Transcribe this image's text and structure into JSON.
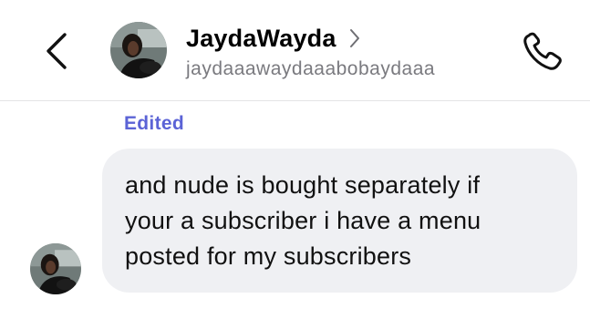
{
  "header": {
    "back_icon": "chevron-left-icon",
    "contact": {
      "display_name": "JaydaWayda",
      "username": "jaydaaawaydaaabobaydaaa",
      "chevron_icon": "chevron-right-icon"
    },
    "call_icon": "phone-icon"
  },
  "conversation": {
    "messages": [
      {
        "status": "Edited",
        "text": "and nude is bought separately if your a subscriber i have a menu posted for my subscribers",
        "lines": [
          "and nude is bought separately if",
          "your a subscriber i have a menu",
          "posted for my subscribers"
        ]
      }
    ]
  },
  "colors": {
    "edited_label": "#5b63d6",
    "bubble_bg": "#eff0f3",
    "username": "#7a7a7f",
    "divider": "#e4e4e6"
  }
}
